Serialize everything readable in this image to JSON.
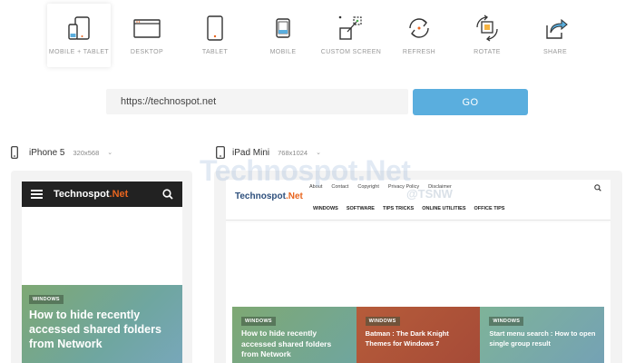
{
  "toolbar": {
    "items": [
      {
        "label": "MOBILE + TABLET",
        "icon": "mobile-tablet-icon",
        "active": true
      },
      {
        "label": "DESKTOP",
        "icon": "desktop-icon"
      },
      {
        "label": "TABLET",
        "icon": "tablet-icon"
      },
      {
        "label": "MOBILE",
        "icon": "mobile-icon"
      },
      {
        "label": "CUSTOM SCREEN",
        "icon": "custom-screen-icon"
      },
      {
        "label": "REFRESH",
        "icon": "refresh-icon"
      },
      {
        "label": "ROTATE",
        "icon": "rotate-icon"
      },
      {
        "label": "SHARE",
        "icon": "share-icon"
      }
    ]
  },
  "url_bar": {
    "value": "https://technospot.net"
  },
  "go_label": "GO",
  "devices": [
    {
      "name": "iPhone 5",
      "size": "320x568"
    },
    {
      "name": "iPad Mini",
      "size": "768x1024"
    }
  ],
  "watermark": {
    "text": "Technospot.Net",
    "sub": "@TSNW"
  },
  "phone_site": {
    "logo_main": "Technospot",
    "logo_accent": ".Net",
    "hero_badge": "WINDOWS",
    "hero_title": "How to hide recently accessed shared folders from Network"
  },
  "tablet_site": {
    "top_links": [
      "About",
      "Contact",
      "Copyright",
      "Privacy Policy",
      "Disclaimer"
    ],
    "logo_main": "Technospot",
    "logo_accent": ".Net",
    "menu": [
      "WINDOWS",
      "SOFTWARE",
      "TIPS TRICKS",
      "ONLINE UTILITIES",
      "OFFICE TIPS"
    ],
    "cards": [
      {
        "badge": "WINDOWS",
        "title": "How to hide recently accessed shared folders from Network"
      },
      {
        "badge": "WINDOWS",
        "title": "Batman : The Dark Knight Themes for Windows 7"
      },
      {
        "badge": "WINDOWS",
        "title": "Start menu search : How to open single group result"
      }
    ]
  },
  "colors": {
    "accent": "#5aaede",
    "logo_orange": "#e8651f"
  }
}
